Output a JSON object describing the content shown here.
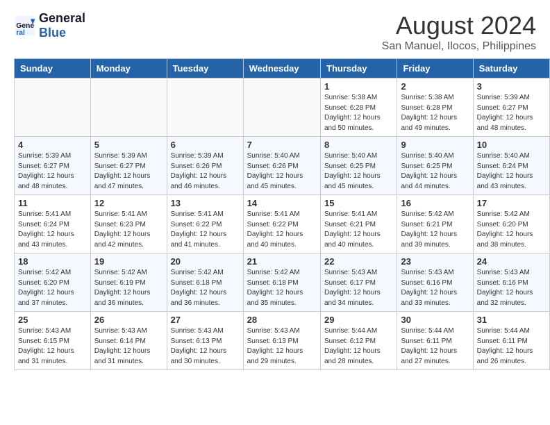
{
  "header": {
    "logo_general": "General",
    "logo_blue": "Blue",
    "month_year": "August 2024",
    "location": "San Manuel, Ilocos, Philippines"
  },
  "days_of_week": [
    "Sunday",
    "Monday",
    "Tuesday",
    "Wednesday",
    "Thursday",
    "Friday",
    "Saturday"
  ],
  "weeks": [
    [
      {
        "day": "",
        "info": ""
      },
      {
        "day": "",
        "info": ""
      },
      {
        "day": "",
        "info": ""
      },
      {
        "day": "",
        "info": ""
      },
      {
        "day": "1",
        "info": "Sunrise: 5:38 AM\nSunset: 6:28 PM\nDaylight: 12 hours\nand 50 minutes."
      },
      {
        "day": "2",
        "info": "Sunrise: 5:38 AM\nSunset: 6:28 PM\nDaylight: 12 hours\nand 49 minutes."
      },
      {
        "day": "3",
        "info": "Sunrise: 5:39 AM\nSunset: 6:27 PM\nDaylight: 12 hours\nand 48 minutes."
      }
    ],
    [
      {
        "day": "4",
        "info": "Sunrise: 5:39 AM\nSunset: 6:27 PM\nDaylight: 12 hours\nand 48 minutes."
      },
      {
        "day": "5",
        "info": "Sunrise: 5:39 AM\nSunset: 6:27 PM\nDaylight: 12 hours\nand 47 minutes."
      },
      {
        "day": "6",
        "info": "Sunrise: 5:39 AM\nSunset: 6:26 PM\nDaylight: 12 hours\nand 46 minutes."
      },
      {
        "day": "7",
        "info": "Sunrise: 5:40 AM\nSunset: 6:26 PM\nDaylight: 12 hours\nand 45 minutes."
      },
      {
        "day": "8",
        "info": "Sunrise: 5:40 AM\nSunset: 6:25 PM\nDaylight: 12 hours\nand 45 minutes."
      },
      {
        "day": "9",
        "info": "Sunrise: 5:40 AM\nSunset: 6:25 PM\nDaylight: 12 hours\nand 44 minutes."
      },
      {
        "day": "10",
        "info": "Sunrise: 5:40 AM\nSunset: 6:24 PM\nDaylight: 12 hours\nand 43 minutes."
      }
    ],
    [
      {
        "day": "11",
        "info": "Sunrise: 5:41 AM\nSunset: 6:24 PM\nDaylight: 12 hours\nand 43 minutes."
      },
      {
        "day": "12",
        "info": "Sunrise: 5:41 AM\nSunset: 6:23 PM\nDaylight: 12 hours\nand 42 minutes."
      },
      {
        "day": "13",
        "info": "Sunrise: 5:41 AM\nSunset: 6:22 PM\nDaylight: 12 hours\nand 41 minutes."
      },
      {
        "day": "14",
        "info": "Sunrise: 5:41 AM\nSunset: 6:22 PM\nDaylight: 12 hours\nand 40 minutes."
      },
      {
        "day": "15",
        "info": "Sunrise: 5:41 AM\nSunset: 6:21 PM\nDaylight: 12 hours\nand 40 minutes."
      },
      {
        "day": "16",
        "info": "Sunrise: 5:42 AM\nSunset: 6:21 PM\nDaylight: 12 hours\nand 39 minutes."
      },
      {
        "day": "17",
        "info": "Sunrise: 5:42 AM\nSunset: 6:20 PM\nDaylight: 12 hours\nand 38 minutes."
      }
    ],
    [
      {
        "day": "18",
        "info": "Sunrise: 5:42 AM\nSunset: 6:20 PM\nDaylight: 12 hours\nand 37 minutes."
      },
      {
        "day": "19",
        "info": "Sunrise: 5:42 AM\nSunset: 6:19 PM\nDaylight: 12 hours\nand 36 minutes."
      },
      {
        "day": "20",
        "info": "Sunrise: 5:42 AM\nSunset: 6:18 PM\nDaylight: 12 hours\nand 36 minutes."
      },
      {
        "day": "21",
        "info": "Sunrise: 5:42 AM\nSunset: 6:18 PM\nDaylight: 12 hours\nand 35 minutes."
      },
      {
        "day": "22",
        "info": "Sunrise: 5:43 AM\nSunset: 6:17 PM\nDaylight: 12 hours\nand 34 minutes."
      },
      {
        "day": "23",
        "info": "Sunrise: 5:43 AM\nSunset: 6:16 PM\nDaylight: 12 hours\nand 33 minutes."
      },
      {
        "day": "24",
        "info": "Sunrise: 5:43 AM\nSunset: 6:16 PM\nDaylight: 12 hours\nand 32 minutes."
      }
    ],
    [
      {
        "day": "25",
        "info": "Sunrise: 5:43 AM\nSunset: 6:15 PM\nDaylight: 12 hours\nand 31 minutes."
      },
      {
        "day": "26",
        "info": "Sunrise: 5:43 AM\nSunset: 6:14 PM\nDaylight: 12 hours\nand 31 minutes."
      },
      {
        "day": "27",
        "info": "Sunrise: 5:43 AM\nSunset: 6:13 PM\nDaylight: 12 hours\nand 30 minutes."
      },
      {
        "day": "28",
        "info": "Sunrise: 5:43 AM\nSunset: 6:13 PM\nDaylight: 12 hours\nand 29 minutes."
      },
      {
        "day": "29",
        "info": "Sunrise: 5:44 AM\nSunset: 6:12 PM\nDaylight: 12 hours\nand 28 minutes."
      },
      {
        "day": "30",
        "info": "Sunrise: 5:44 AM\nSunset: 6:11 PM\nDaylight: 12 hours\nand 27 minutes."
      },
      {
        "day": "31",
        "info": "Sunrise: 5:44 AM\nSunset: 6:11 PM\nDaylight: 12 hours\nand 26 minutes."
      }
    ]
  ]
}
